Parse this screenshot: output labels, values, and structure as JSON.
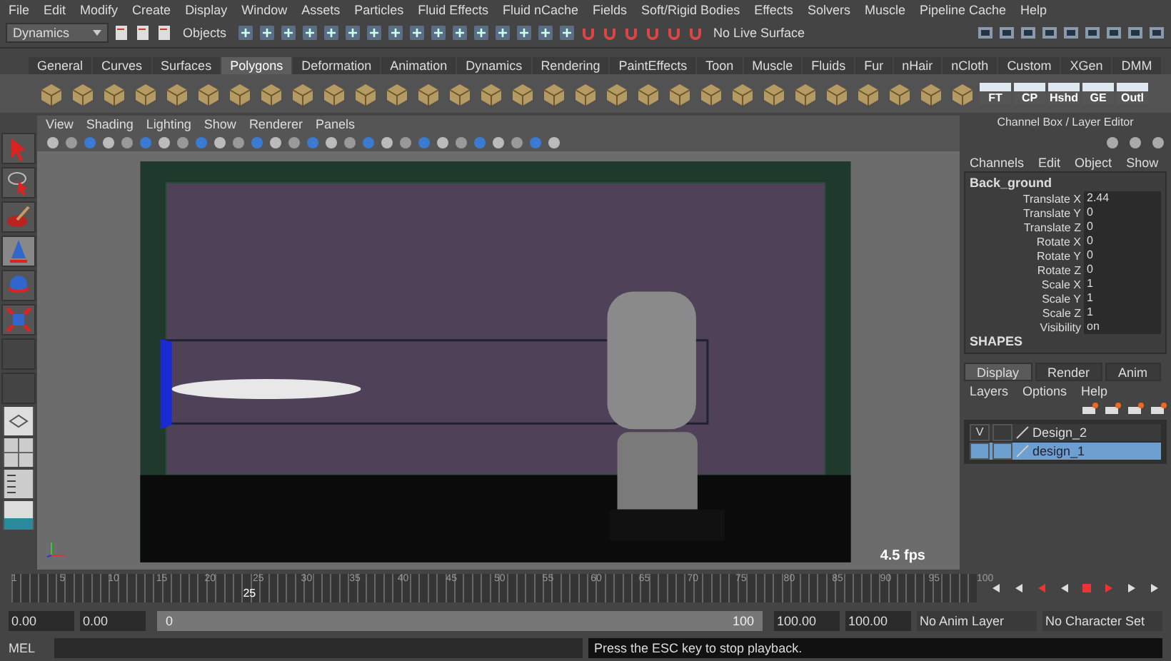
{
  "menu_bar": [
    "File",
    "Edit",
    "Modify",
    "Create",
    "Display",
    "Window",
    "Assets",
    "Particles",
    "Fluid Effects",
    "Fluid nCache",
    "Fields",
    "Soft/Rigid Bodies",
    "Effects",
    "Solvers",
    "Muscle",
    "Pipeline Cache",
    "Help"
  ],
  "status_line": {
    "menu_set": "Dynamics",
    "selection_mode": "Objects",
    "live_surface": "No Live Surface"
  },
  "shelf": {
    "tabs": [
      {
        "label": "General",
        "selected": false
      },
      {
        "label": "Curves",
        "selected": false
      },
      {
        "label": "Surfaces",
        "selected": false
      },
      {
        "label": "Polygons",
        "selected": true
      },
      {
        "label": "Deformation",
        "selected": false
      },
      {
        "label": "Animation",
        "selected": false
      },
      {
        "label": "Dynamics",
        "selected": false
      },
      {
        "label": "Rendering",
        "selected": false
      },
      {
        "label": "PaintEffects",
        "selected": false
      },
      {
        "label": "Toon",
        "selected": false
      },
      {
        "label": "Muscle",
        "selected": false
      },
      {
        "label": "Fluids",
        "selected": false
      },
      {
        "label": "Fur",
        "selected": false
      },
      {
        "label": "nHair",
        "selected": false
      },
      {
        "label": "nCloth",
        "selected": false
      },
      {
        "label": "Custom",
        "selected": false
      },
      {
        "label": "XGen",
        "selected": false
      },
      {
        "label": "DMM",
        "selected": false
      }
    ],
    "buttons": [
      {
        "label": "FT"
      },
      {
        "label": "CP"
      },
      {
        "label": "Hshd"
      },
      {
        "label": "GE"
      },
      {
        "label": "Outl"
      }
    ]
  },
  "panel_menu": [
    "View",
    "Shading",
    "Lighting",
    "Show",
    "Renderer",
    "Panels"
  ],
  "viewport": {
    "fps": "4.5 fps"
  },
  "channel_box": {
    "title": "Channel Box / Layer Editor",
    "menus": [
      "Channels",
      "Edit",
      "Object",
      "Show"
    ],
    "object": "Back_ground",
    "attributes": [
      {
        "name": "Translate X",
        "value": "2.44"
      },
      {
        "name": "Translate Y",
        "value": "0"
      },
      {
        "name": "Translate Z",
        "value": "0"
      },
      {
        "name": "Rotate X",
        "value": "0"
      },
      {
        "name": "Rotate Y",
        "value": "0"
      },
      {
        "name": "Rotate Z",
        "value": "0"
      },
      {
        "name": "Scale X",
        "value": "1"
      },
      {
        "name": "Scale Y",
        "value": "1"
      },
      {
        "name": "Scale Z",
        "value": "1"
      },
      {
        "name": "Visibility",
        "value": "on"
      }
    ],
    "section": "SHAPES"
  },
  "layer_editor": {
    "visible_marker": "V",
    "tabs": [
      {
        "label": "Display",
        "selected": true
      },
      {
        "label": "Render",
        "selected": false
      },
      {
        "label": "Anim",
        "selected": false
      }
    ],
    "menus": [
      "Layers",
      "Options",
      "Help"
    ],
    "layers": [
      {
        "name": "Design_2",
        "visible": true,
        "selected": false
      },
      {
        "name": "design_1",
        "visible": false,
        "selected": true
      }
    ]
  },
  "time_slider": {
    "ticks": [
      "1",
      "5",
      "10",
      "15",
      "20",
      "25",
      "30",
      "35",
      "40",
      "45",
      "50",
      "55",
      "60",
      "65",
      "70",
      "75",
      "80",
      "85",
      "90",
      "95",
      "100"
    ],
    "current_frame": "25",
    "level": 0.24
  },
  "range_slider": {
    "start": "0.00",
    "range_start": "0.00",
    "slider_start": "0",
    "slider_end": "100",
    "level": 1,
    "range_end": "100.00",
    "end": "100.00",
    "anim_layer": "No Anim Layer",
    "character_set": "No Character Set"
  },
  "command_line": {
    "label": "MEL",
    "help": "Press the ESC key to stop playback."
  }
}
